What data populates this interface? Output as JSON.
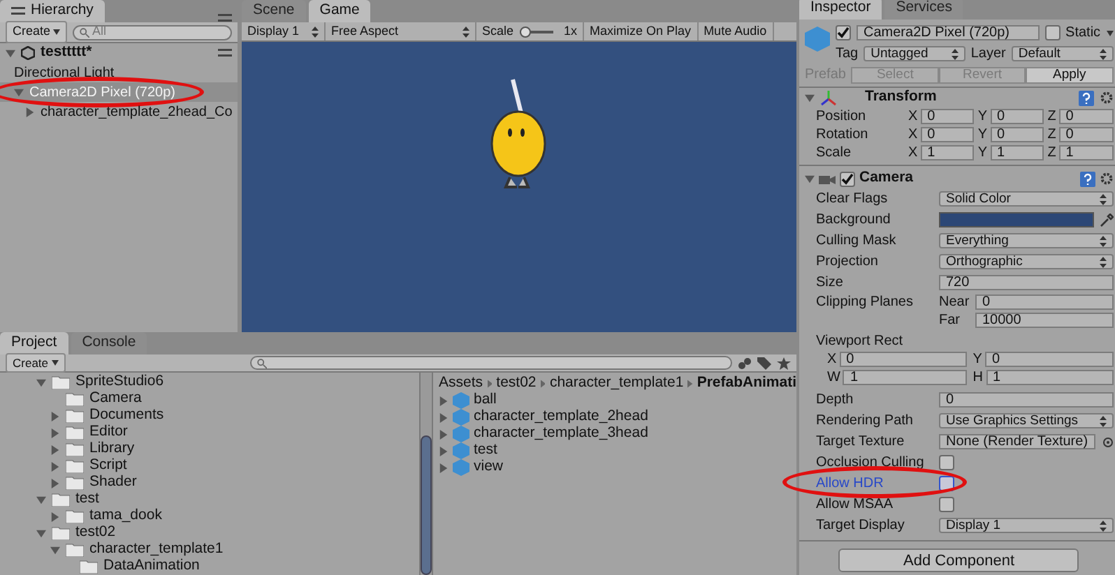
{
  "hierarchy": {
    "tab": "Hierarchy",
    "create": "Create",
    "search_placeholder": "All",
    "scene": "testtttt*",
    "items": [
      {
        "label": "Directional Light",
        "selected": false
      },
      {
        "label": "Camera2D Pixel (720p)",
        "selected": true,
        "expanded": true,
        "children": [
          {
            "label": "character_template_2head_Co",
            "selected": false,
            "expanded": false
          }
        ]
      }
    ]
  },
  "game": {
    "tabs": [
      {
        "label": "Scene",
        "selected": false
      },
      {
        "label": "Game",
        "selected": true
      }
    ],
    "display": "Display 1",
    "aspect": "Free Aspect",
    "scale_label": "Scale",
    "scale": {
      "level": 0
    },
    "scale_value": "1x",
    "buttons": [
      "Maximize On Play",
      "Mute Audio"
    ]
  },
  "project": {
    "tabs": [
      {
        "label": "Project",
        "selected": true
      },
      {
        "label": "Console",
        "selected": false
      }
    ],
    "create": "Create",
    "tree": [
      {
        "label": "SpriteStudio6",
        "expanded": true,
        "children": [
          {
            "label": "Camera"
          },
          {
            "label": "Documents",
            "expanded": false
          },
          {
            "label": "Editor",
            "expanded": false
          },
          {
            "label": "Library",
            "expanded": false
          },
          {
            "label": "Script",
            "expanded": false
          },
          {
            "label": "Shader",
            "expanded": false
          }
        ]
      },
      {
        "label": "test",
        "expanded": true,
        "children": [
          {
            "label": "tama_dook",
            "expanded": false
          }
        ]
      },
      {
        "label": "test02",
        "expanded": true,
        "children": [
          {
            "label": "character_template1",
            "expanded": true,
            "children": [
              {
                "label": "DataAnimation"
              }
            ]
          }
        ]
      }
    ],
    "breadcrumb": [
      "Assets",
      "test02",
      "character_template1",
      "PrefabAnimati"
    ],
    "assets": [
      "ball",
      "character_template_2head",
      "character_template_3head",
      "test",
      "view"
    ]
  },
  "inspector": {
    "tabs": [
      {
        "label": "Inspector",
        "selected": true
      },
      {
        "label": "Services",
        "selected": false
      }
    ],
    "active": true,
    "name": "Camera2D Pixel (720p)",
    "static_label": "Static",
    "static": false,
    "tag_label": "Tag",
    "tag": "Untagged",
    "layer_label": "Layer",
    "layer": "Default",
    "prefab_label": "Prefab",
    "prefab_buttons": [
      {
        "label": "Select",
        "disabled": true
      },
      {
        "label": "Revert",
        "disabled": true
      },
      {
        "label": "Apply",
        "disabled": false
      }
    ],
    "transform": {
      "title": "Transform",
      "rows": [
        {
          "label": "Position",
          "values": [
            {
              "axis": "X",
              "value": "0"
            },
            {
              "axis": "Y",
              "value": "0"
            },
            {
              "axis": "Z",
              "value": "0"
            }
          ]
        },
        {
          "label": "Rotation",
          "values": [
            {
              "axis": "X",
              "value": "0"
            },
            {
              "axis": "Y",
              "value": "0"
            },
            {
              "axis": "Z",
              "value": "0"
            }
          ]
        },
        {
          "label": "Scale",
          "values": [
            {
              "axis": "X",
              "value": "1"
            },
            {
              "axis": "Y",
              "value": "1"
            },
            {
              "axis": "Z",
              "value": "1"
            }
          ]
        }
      ]
    },
    "camera": {
      "title": "Camera",
      "enabled": true,
      "props": [
        {
          "kind": "dropdown",
          "label": "Clear Flags",
          "value": "Solid Color"
        },
        {
          "kind": "color",
          "label": "Background",
          "color": "#2c4776"
        },
        {
          "kind": "dropdown",
          "label": "Culling Mask",
          "value": "Everything"
        },
        {
          "kind": "dropdown",
          "label": "Projection",
          "value": "Orthographic"
        },
        {
          "kind": "field",
          "label": "Size",
          "value": "720"
        },
        {
          "kind": "planes",
          "label": "Clipping Planes",
          "near_label": "Near",
          "near": "0",
          "far_label": "Far",
          "far": "10000"
        },
        {
          "kind": "rect",
          "label": "Viewport Rect",
          "values": [
            {
              "axis": "X",
              "value": "0"
            },
            {
              "axis": "Y",
              "value": "0"
            },
            {
              "axis": "W",
              "value": "1"
            },
            {
              "axis": "H",
              "value": "1"
            }
          ]
        },
        {
          "kind": "field",
          "label": "Depth",
          "value": "0"
        },
        {
          "kind": "dropdown",
          "label": "Rendering Path",
          "value": "Use Graphics Settings"
        },
        {
          "kind": "object",
          "label": "Target Texture",
          "value": "None (Render Texture)"
        },
        {
          "kind": "checkbox",
          "label": "Occlusion Culling",
          "checked": false,
          "focused": false
        },
        {
          "kind": "checkbox",
          "label": "Allow HDR",
          "checked": false,
          "focused": true
        },
        {
          "kind": "checkbox",
          "label": "Allow MSAA",
          "checked": false,
          "focused": false
        },
        {
          "kind": "dropdown",
          "label": "Target Display",
          "value": "Display 1"
        }
      ]
    },
    "add_component": "Add Component"
  }
}
